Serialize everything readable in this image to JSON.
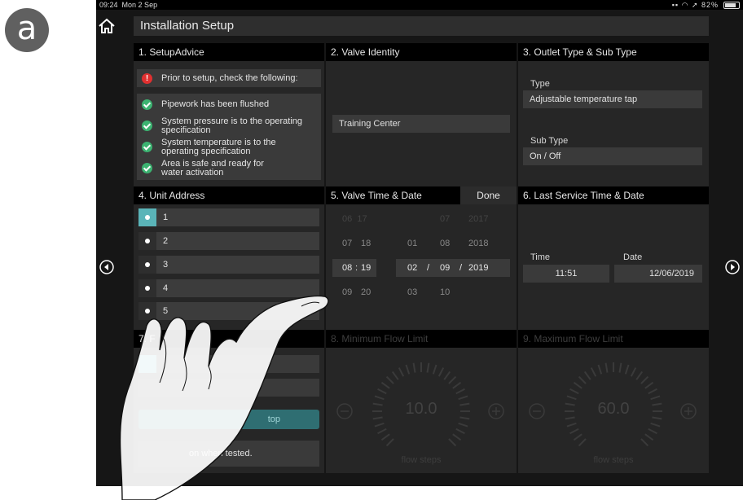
{
  "figure_label": "a",
  "status_bar": {
    "time": "09:24",
    "date": "Mon 2 Sep",
    "battery": "82%"
  },
  "header": {
    "title": "Installation Setup"
  },
  "panel1": {
    "title": "1. SetupAdvice",
    "prompt": "Prior to setup, check the following:",
    "checks": [
      {
        "l1": "Pipework has been flushed",
        "l2": ""
      },
      {
        "l1": "System pressure is to the operating",
        "l2": "specification"
      },
      {
        "l1": "System temperature is to the",
        "l2": "operating specification"
      },
      {
        "l1": "Area is safe and ready for",
        "l2": "water activation"
      }
    ]
  },
  "panel2": {
    "title": "2. Valve Identity",
    "value": "Training Center"
  },
  "panel3": {
    "title": "3. Outlet Type & Sub Type",
    "type_label": "Type",
    "type_value": "Adjustable temperature tap",
    "subtype_label": "Sub Type",
    "subtype_value": "On / Off"
  },
  "panel4": {
    "title": "4. Unit Address",
    "addresses": [
      "1",
      "2",
      "3",
      "4",
      "5"
    ],
    "selected": "1"
  },
  "panel5": {
    "title": "5. Valve Time & Date",
    "done_label": "Done",
    "time_rows": [
      [
        "07",
        "18"
      ],
      [
        "08",
        "19"
      ],
      [
        "09",
        "20"
      ]
    ],
    "day_rows": [
      "01",
      "02",
      "03"
    ],
    "month_rows": [
      "08",
      "09",
      "10"
    ],
    "year_rows": [
      "2018",
      "2019",
      ""
    ],
    "sep_time": ":",
    "sep_date": "/"
  },
  "panel6": {
    "title": "6. Last Service Time & Date",
    "time_label": "Time",
    "time_value": "11:51",
    "date_label": "Date",
    "date_value": "12/06/2019"
  },
  "panel7": {
    "title": "7. F",
    "button_label": "top",
    "note": "on when tested."
  },
  "panel8": {
    "title": "8. Minimum Flow Limit",
    "value": "10.0",
    "caption": "flow steps"
  },
  "panel9": {
    "title": "9. Maximum Flow Limit",
    "value": "60.0",
    "caption": "flow steps"
  },
  "icons": [
    "home-icon",
    "prev-arrow-icon",
    "next-arrow-icon",
    "check-icon",
    "warning-icon",
    "minus-icon",
    "plus-icon",
    "hand"
  ],
  "colors": {
    "accent": "#5ab4b8",
    "check": "#3cb371",
    "warning": "#e03030",
    "panel": "#262626",
    "panel_header": "#000000"
  }
}
